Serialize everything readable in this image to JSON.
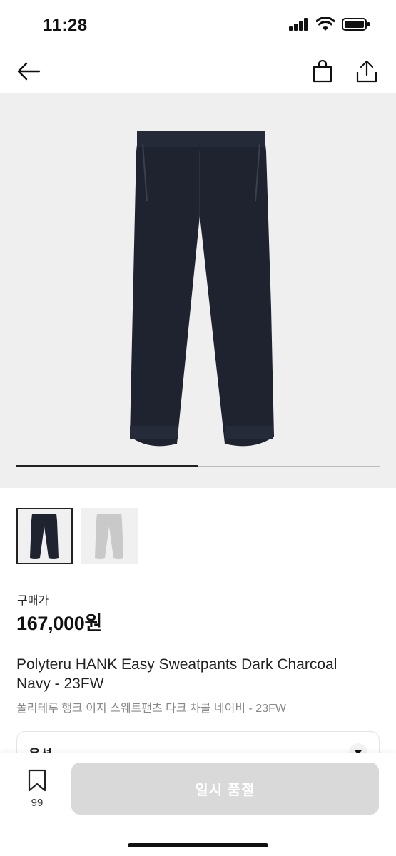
{
  "status": {
    "time": "11:28"
  },
  "nav": {
    "back_icon": "back-arrow-icon",
    "bag_icon": "shopping-bag-icon",
    "share_icon": "share-icon"
  },
  "gallery": {
    "slide_progress": 0.5,
    "thumbnails": [
      {
        "color": "#1f2330",
        "selected": true
      },
      {
        "color": "#c9c9c9",
        "selected": false
      }
    ]
  },
  "product": {
    "price_label": "구매가",
    "price": "167,000원",
    "title_en": "Polyteru HANK Easy Sweatpants Dark Charcoal Navy - 23FW",
    "title_ko": "폴리테루 행크 이지 스웨트팬츠 다크 차콜 네이비 - 23FW"
  },
  "options": {
    "label": "옵션"
  },
  "bottom": {
    "wish_count": "99",
    "buy_label": "일시 품절"
  },
  "colors": {
    "button_disabled": "#d9d9d9",
    "hero_bg": "#efefef",
    "pants": "#1f2330"
  }
}
